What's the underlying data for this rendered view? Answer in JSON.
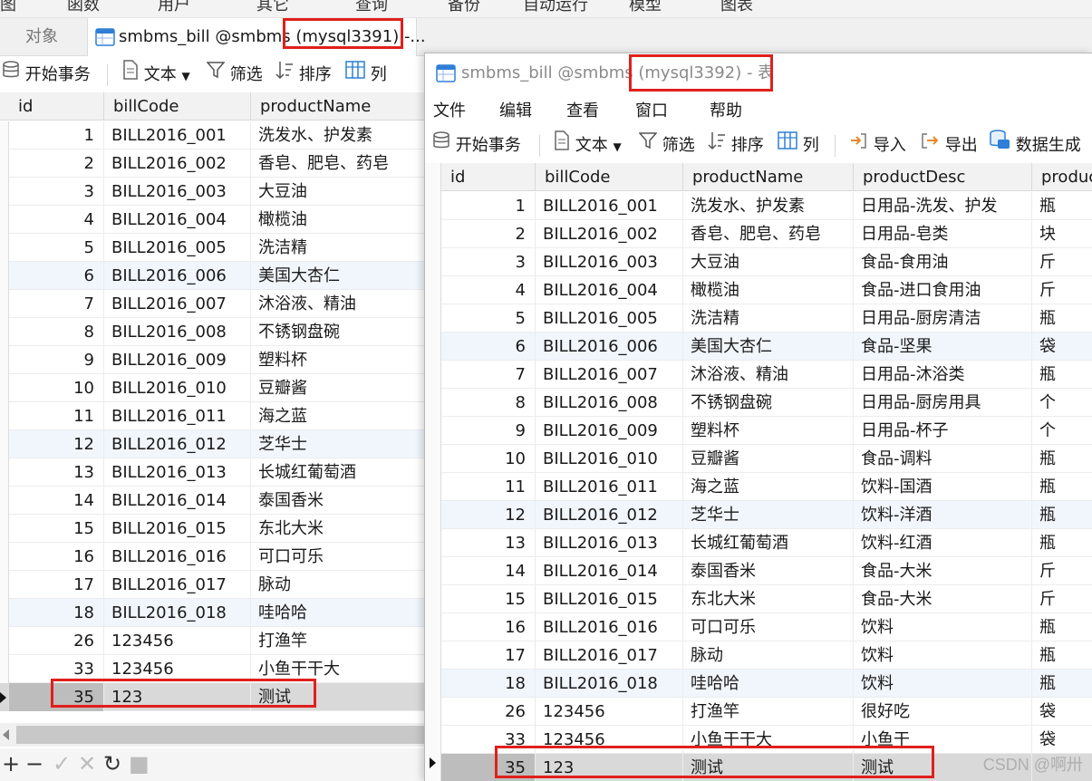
{
  "top_menu": [
    "函数",
    "用户",
    "其它",
    "查询",
    "备份",
    "自动运行",
    "模型",
    "图表"
  ],
  "back_window": {
    "objects_tab": "对象",
    "tab_title": "smbms_bill @smbms (mysql3391) -...",
    "toolbar": {
      "begin_tx": "开始事务",
      "text": "文本",
      "filter": "筛选",
      "sort": "排序",
      "columns": "列"
    },
    "columns": [
      "id",
      "billCode",
      "productName"
    ],
    "rows": [
      [
        "1",
        "BILL2016_001",
        "洗发水、护发素"
      ],
      [
        "2",
        "BILL2016_002",
        "香皂、肥皂、药皂"
      ],
      [
        "3",
        "BILL2016_003",
        "大豆油"
      ],
      [
        "4",
        "BILL2016_004",
        "橄榄油"
      ],
      [
        "5",
        "BILL2016_005",
        "洗洁精"
      ],
      [
        "6",
        "BILL2016_006",
        "美国大杏仁"
      ],
      [
        "7",
        "BILL2016_007",
        "沐浴液、精油"
      ],
      [
        "8",
        "BILL2016_008",
        "不锈钢盘碗"
      ],
      [
        "9",
        "BILL2016_009",
        "塑料杯"
      ],
      [
        "10",
        "BILL2016_010",
        "豆瓣酱"
      ],
      [
        "11",
        "BILL2016_011",
        "海之蓝"
      ],
      [
        "12",
        "BILL2016_012",
        "芝华士"
      ],
      [
        "13",
        "BILL2016_013",
        "长城红葡萄酒"
      ],
      [
        "14",
        "BILL2016_014",
        "泰国香米"
      ],
      [
        "15",
        "BILL2016_015",
        "东北大米"
      ],
      [
        "16",
        "BILL2016_016",
        "可口可乐"
      ],
      [
        "17",
        "BILL2016_017",
        "脉动"
      ],
      [
        "18",
        "BILL2016_018",
        "哇哈哈"
      ],
      [
        "26",
        "123456",
        "打渔竿"
      ],
      [
        "33",
        "123456",
        "小鱼干干大"
      ],
      [
        "35",
        "123",
        "测试"
      ]
    ],
    "bottom_controls": [
      "+",
      "−",
      "✓",
      "✕",
      "↻",
      "■"
    ]
  },
  "front_window": {
    "title": "smbms_bill @smbms (mysql3392) - 表",
    "menu": [
      "文件",
      "编辑",
      "查看",
      "窗口",
      "帮助"
    ],
    "toolbar": {
      "begin_tx": "开始事务",
      "text": "文本",
      "filter": "筛选",
      "sort": "排序",
      "columns": "列",
      "import": "导入",
      "export": "导出",
      "generate": "数据生成"
    },
    "columns": [
      "id",
      "billCode",
      "productName",
      "productDesc",
      "produc"
    ],
    "rows": [
      [
        "1",
        "BILL2016_001",
        "洗发水、护发素",
        "日用品-洗发、护发",
        "瓶"
      ],
      [
        "2",
        "BILL2016_002",
        "香皂、肥皂、药皂",
        "日用品-皂类",
        "块"
      ],
      [
        "3",
        "BILL2016_003",
        "大豆油",
        "食品-食用油",
        "斤"
      ],
      [
        "4",
        "BILL2016_004",
        "橄榄油",
        "食品-进口食用油",
        "斤"
      ],
      [
        "5",
        "BILL2016_005",
        "洗洁精",
        "日用品-厨房清洁",
        "瓶"
      ],
      [
        "6",
        "BILL2016_006",
        "美国大杏仁",
        "食品-坚果",
        "袋"
      ],
      [
        "7",
        "BILL2016_007",
        "沐浴液、精油",
        "日用品-沐浴类",
        "瓶"
      ],
      [
        "8",
        "BILL2016_008",
        "不锈钢盘碗",
        "日用品-厨房用具",
        "个"
      ],
      [
        "9",
        "BILL2016_009",
        "塑料杯",
        "日用品-杯子",
        "个"
      ],
      [
        "10",
        "BILL2016_010",
        "豆瓣酱",
        "食品-调料",
        "瓶"
      ],
      [
        "11",
        "BILL2016_011",
        "海之蓝",
        "饮料-国酒",
        "瓶"
      ],
      [
        "12",
        "BILL2016_012",
        "芝华士",
        "饮料-洋酒",
        "瓶"
      ],
      [
        "13",
        "BILL2016_013",
        "长城红葡萄酒",
        "饮料-红酒",
        "瓶"
      ],
      [
        "14",
        "BILL2016_014",
        "泰国香米",
        "食品-大米",
        "斤"
      ],
      [
        "15",
        "BILL2016_015",
        "东北大米",
        "食品-大米",
        "斤"
      ],
      [
        "16",
        "BILL2016_016",
        "可口可乐",
        "饮料",
        "瓶"
      ],
      [
        "17",
        "BILL2016_017",
        "脉动",
        "饮料",
        "瓶"
      ],
      [
        "18",
        "BILL2016_018",
        "哇哈哈",
        "饮料",
        "瓶"
      ],
      [
        "26",
        "123456",
        "打渔竿",
        "很好吃",
        "袋"
      ],
      [
        "33",
        "123456",
        "小鱼干干大",
        "小鱼干",
        "袋"
      ],
      [
        "35",
        "123",
        "测试",
        "测试",
        ""
      ]
    ]
  },
  "watermark": "CSDN @啊卅",
  "colors": {
    "annotation_red": "#e0201c",
    "alt_row": "#f1f6fd",
    "selected_row": "#d9d9d9"
  }
}
